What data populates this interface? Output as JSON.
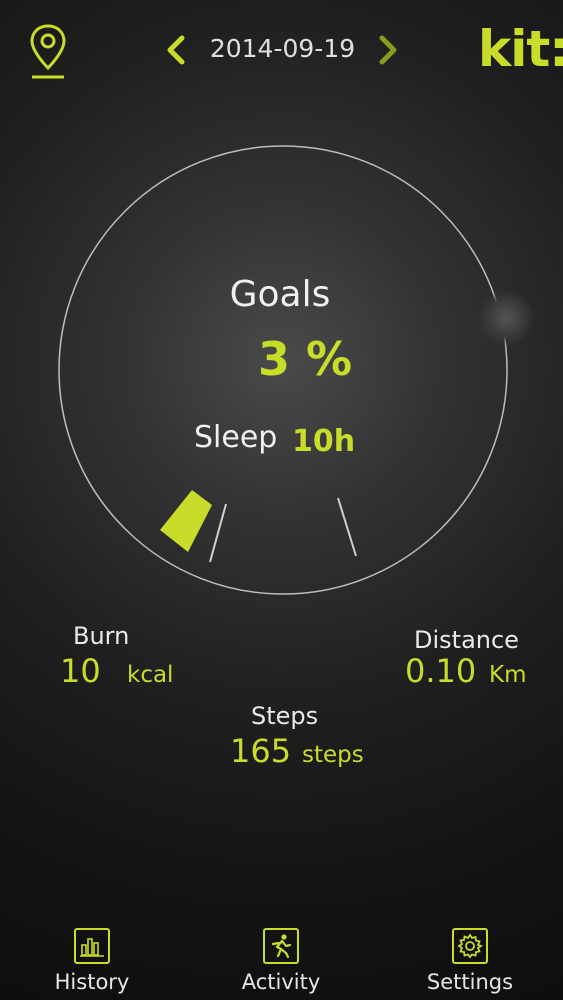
{
  "header": {
    "date": "2014-09-19",
    "brand": "kit:"
  },
  "dial": {
    "goals_label": "Goals",
    "goals_value": "3 %",
    "progress_fraction": 0.03,
    "sleep_label": "Sleep",
    "sleep_value": "10h"
  },
  "stats": {
    "burn": {
      "label": "Burn",
      "value": "10",
      "unit": "kcal"
    },
    "distance": {
      "label": "Distance",
      "value": "0.10",
      "unit": "Km"
    },
    "steps": {
      "label": "Steps",
      "value": "165",
      "unit": "steps"
    }
  },
  "nav": {
    "history": {
      "label": "History",
      "icon": "bar-chart-icon"
    },
    "activity": {
      "label": "Activity",
      "icon": "runner-icon"
    },
    "settings": {
      "label": "Settings",
      "icon": "gear-icon"
    }
  },
  "colors": {
    "accent": "#c9dc2a",
    "text": "#e8e8e8",
    "background": "#1a1a1a"
  }
}
